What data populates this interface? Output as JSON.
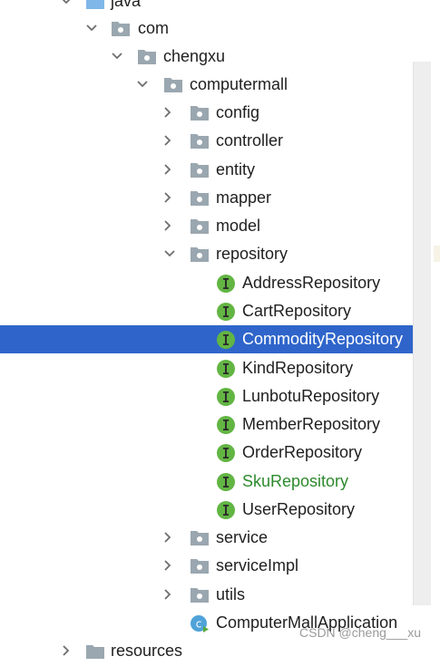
{
  "tree": {
    "items": [
      {
        "label": "java",
        "icon": "folder-icon",
        "expanded": true
      },
      {
        "label": "com",
        "icon": "package-icon",
        "expanded": true
      },
      {
        "label": "chengxu",
        "icon": "package-icon",
        "expanded": true
      },
      {
        "label": "computermall",
        "icon": "package-icon",
        "expanded": true
      },
      {
        "label": "config",
        "icon": "package-icon",
        "expanded": false
      },
      {
        "label": "controller",
        "icon": "package-icon",
        "expanded": false
      },
      {
        "label": "entity",
        "icon": "package-icon",
        "expanded": false
      },
      {
        "label": "mapper",
        "icon": "package-icon",
        "expanded": false
      },
      {
        "label": "model",
        "icon": "package-icon",
        "expanded": false
      },
      {
        "label": "repository",
        "icon": "package-icon",
        "expanded": true
      },
      {
        "label": "AddressRepository",
        "icon": "interface-icon"
      },
      {
        "label": "CartRepository",
        "icon": "interface-icon"
      },
      {
        "label": "CommodityRepository",
        "icon": "interface-icon",
        "selected": true
      },
      {
        "label": "KindRepository",
        "icon": "interface-icon"
      },
      {
        "label": "LunbotuRepository",
        "icon": "interface-icon"
      },
      {
        "label": "MemberRepository",
        "icon": "interface-icon"
      },
      {
        "label": "OrderRepository",
        "icon": "interface-icon"
      },
      {
        "label": "SkuRepository",
        "icon": "interface-icon",
        "vcs_status": "added"
      },
      {
        "label": "UserRepository",
        "icon": "interface-icon"
      },
      {
        "label": "service",
        "icon": "package-icon",
        "expanded": false
      },
      {
        "label": "serviceImpl",
        "icon": "package-icon",
        "expanded": false
      },
      {
        "label": "utils",
        "icon": "package-icon",
        "expanded": false
      },
      {
        "label": "ComputerMallApplication",
        "icon": "spring-boot-class-icon"
      },
      {
        "label": "resources",
        "icon": "folder-icon",
        "expanded": false
      }
    ]
  },
  "watermark": "CSDN @cheng___xu",
  "colors": {
    "selection": "#2f65ca",
    "folder": "#9aa7b0",
    "interface": "#62b543",
    "vcs_added": "#2d8a2d"
  }
}
